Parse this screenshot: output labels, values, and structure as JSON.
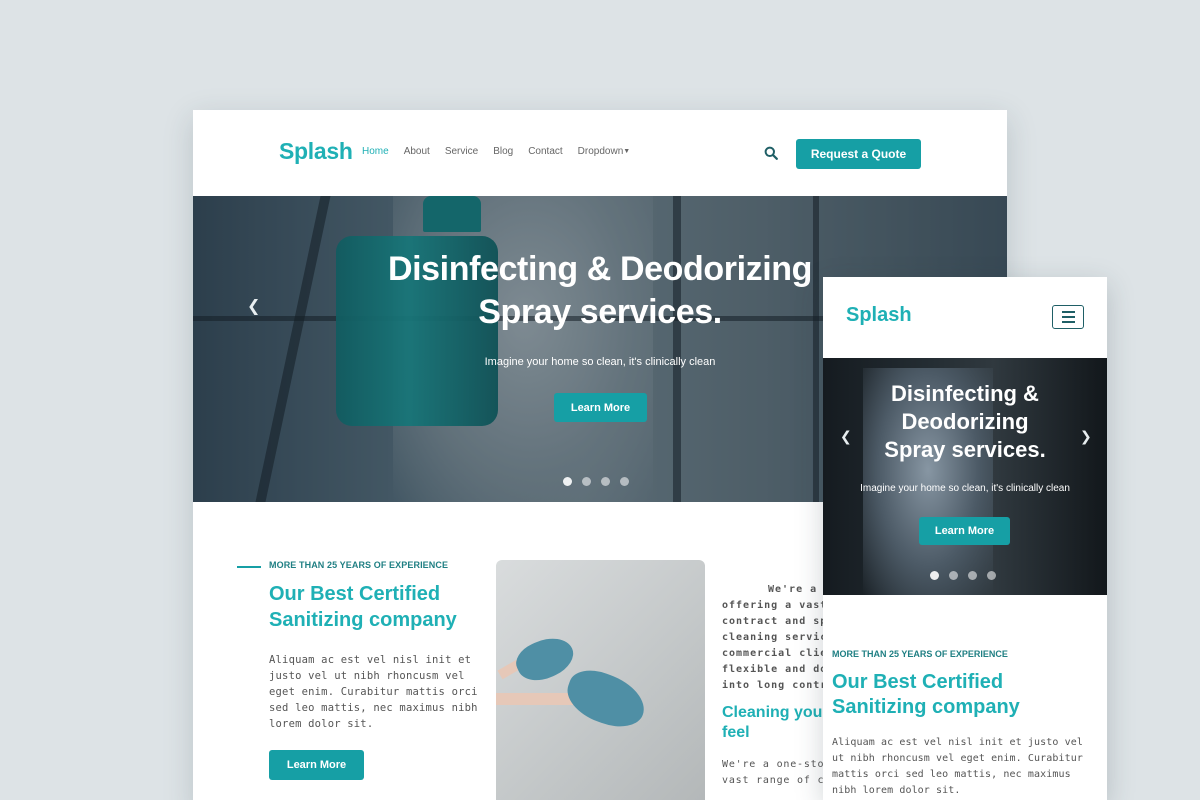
{
  "brand": {
    "name": "Splash",
    "accent": "#1fb0b5",
    "button": "#169fa5"
  },
  "desktop": {
    "nav": {
      "items": [
        "Home",
        "About",
        "Service",
        "Blog",
        "Contact",
        "Dropdown"
      ],
      "active": "Home",
      "search_icon": "search-icon",
      "quote_button": "Request a Quote"
    },
    "hero": {
      "title_line1": "Disinfecting & Deodorizing",
      "title_line2": "Spray services.",
      "subtitle": "Imagine your home so clean, it's clinically clean",
      "cta": "Learn More",
      "prev_icon": "chevron-left-icon",
      "slides": 4,
      "active_slide": 1
    },
    "about": {
      "eyebrow": "MORE THAN 25 YEARS OF EXPERIENCE",
      "heading_line1": "Our Best Certified",
      "heading_line2": "Sanitizing company",
      "paragraph": "Aliquam ac est vel nisl init et justo vel ut nibh rhoncusm vel eget enim. Curabitur mattis orci sed leo mattis, nec maximus nibh lorem dolor sit.",
      "cta": "Learn More",
      "col3_lines": [
        "We're a",
        "offering a vast",
        "contract and sp",
        "cleaning servic",
        "commercial clie",
        "flexible and do",
        "into long contr"
      ],
      "col3_heading_line1": "Cleaning you",
      "col3_heading_line2": "feel",
      "col3b_lines": [
        "We're a one-stop",
        "vast range of cle"
      ]
    }
  },
  "mobile": {
    "menu_icon": "hamburger-menu-icon",
    "hero": {
      "title_line1": "Disinfecting &",
      "title_line2": "Deodorizing",
      "title_line3": "Spray services.",
      "subtitle": "Imagine your home so clean, it's clinically clean",
      "cta": "Learn More",
      "prev_icon": "chevron-left-icon",
      "next_icon": "chevron-right-icon",
      "slides": 4,
      "active_slide": 1
    },
    "about": {
      "eyebrow": "MORE THAN 25 YEARS OF EXPERIENCE",
      "heading_line1": "Our Best Certified",
      "heading_line2": "Sanitizing company",
      "paragraph": "Aliquam ac est vel nisl init et justo vel ut nibh rhoncusm vel eget enim. Curabitur mattis orci sed leo mattis, nec maximus nibh lorem dolor sit."
    }
  }
}
